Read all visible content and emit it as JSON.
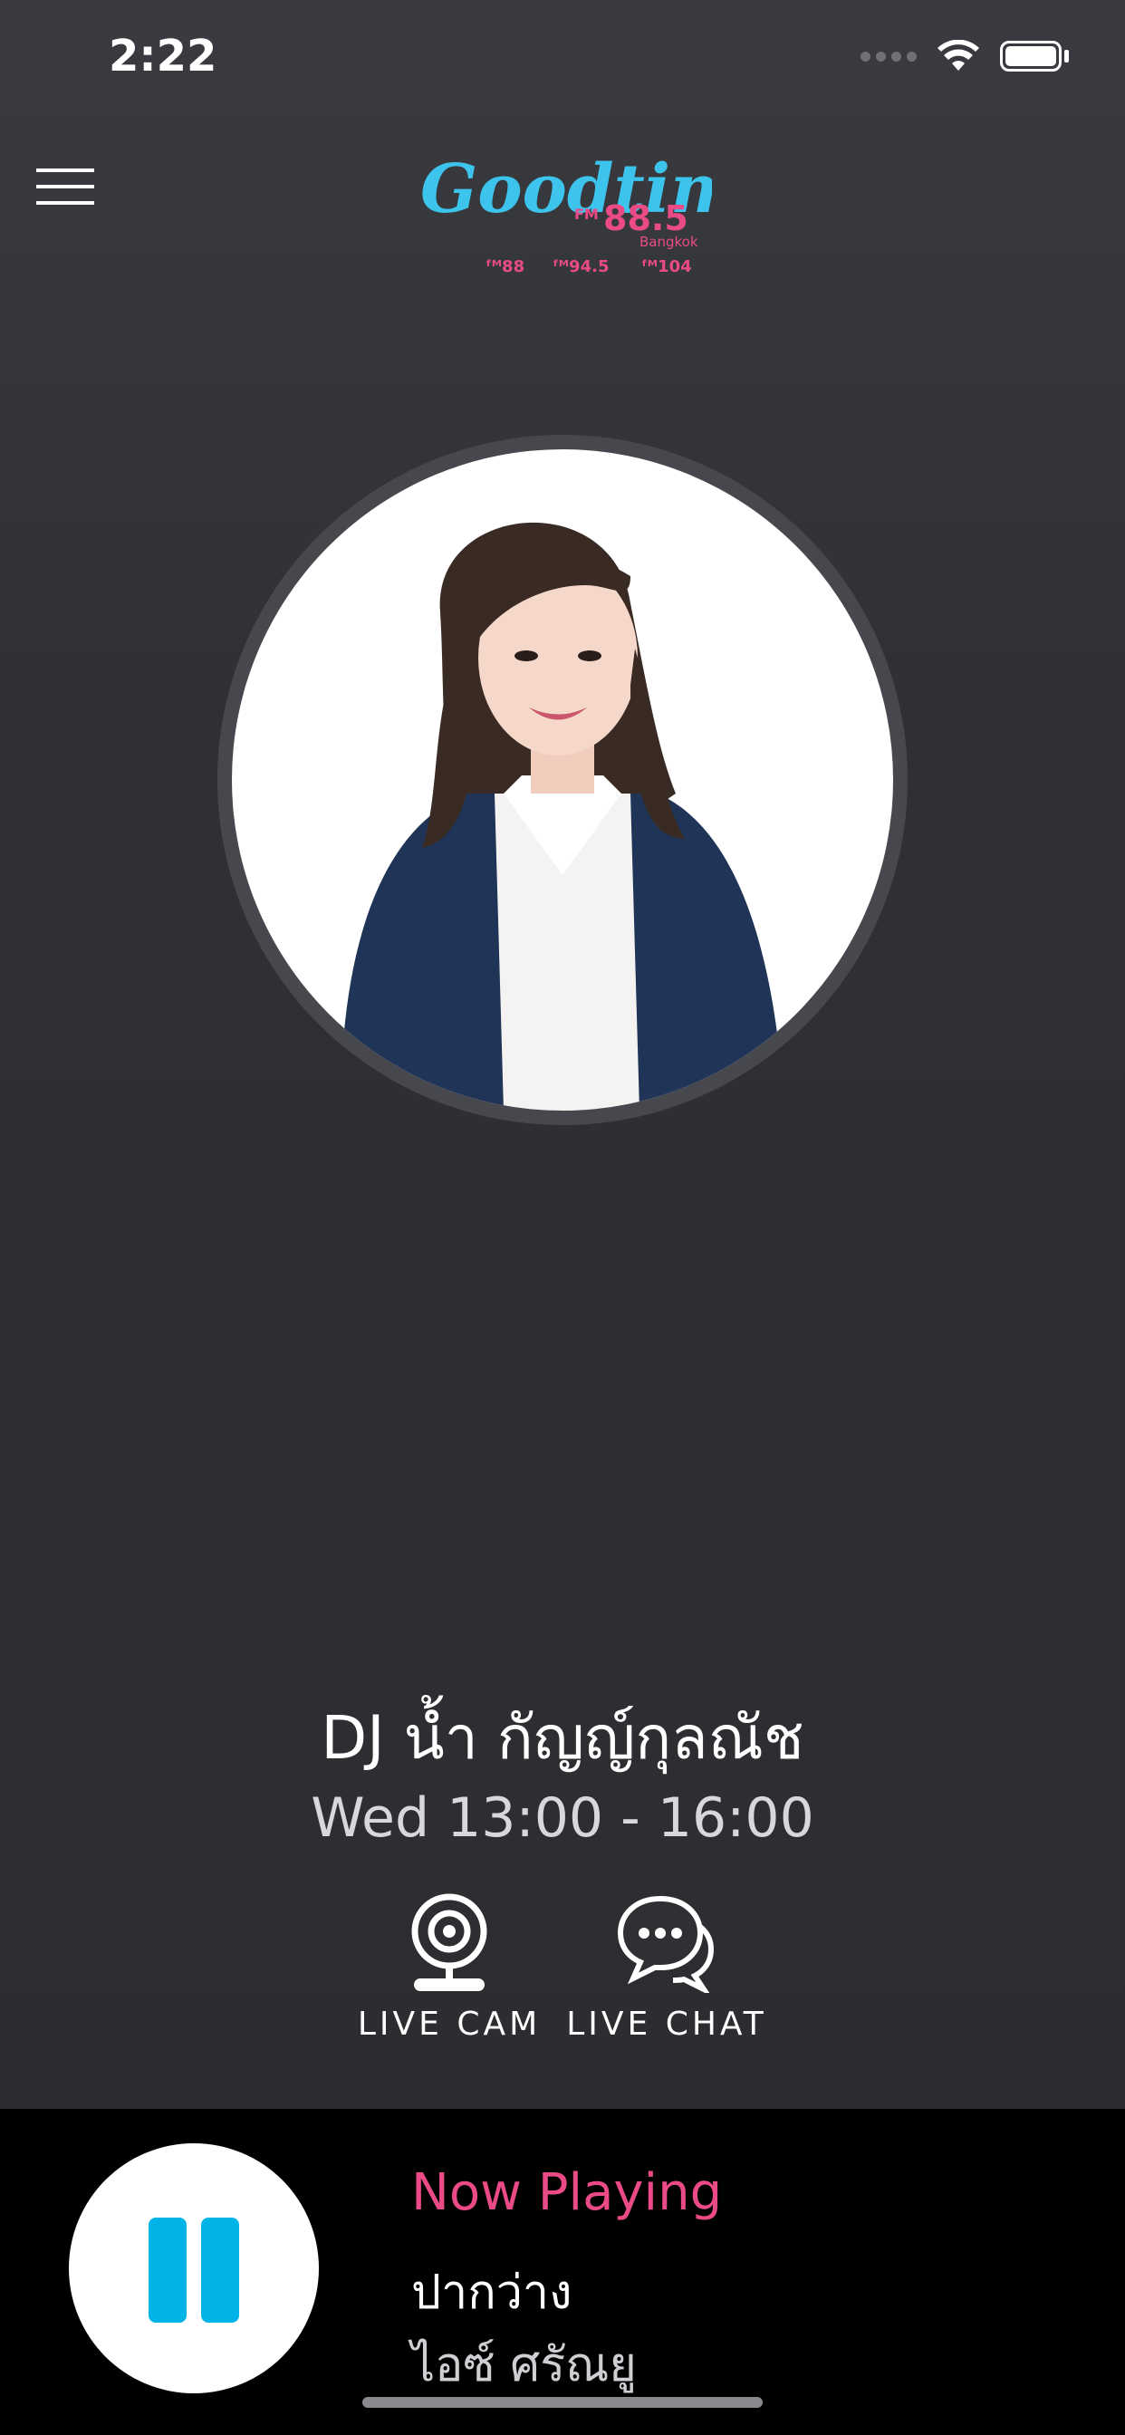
{
  "status_bar": {
    "time": "2:22",
    "wifi_icon": "wifi-icon",
    "battery_icon": "battery-icon"
  },
  "header": {
    "menu_icon": "hamburger-menu-icon",
    "logo": {
      "brand": "Goodtime",
      "main_frequency": "FM 88.5",
      "main_city": "Bangkok",
      "stations": [
        "FM 88",
        "FM 94.5",
        "FM 104"
      ]
    }
  },
  "dj": {
    "name": "DJ น้ำ กัญญ์กุลณัช",
    "schedule": "Wed 13:00 - 16:00"
  },
  "actions": [
    {
      "label": "LIVE CAM",
      "icon": "webcam-icon"
    },
    {
      "label": "LIVE CHAT",
      "icon": "chat-bubbles-icon"
    }
  ],
  "player": {
    "state_icon": "pause-icon",
    "now_playing_label": "Now Playing",
    "song": "ปากว่าง",
    "artist": "ไอซ์ ศรัณยู"
  },
  "colors": {
    "accent_pink": "#ea4a86",
    "accent_blue": "#00b4e8",
    "logo_blue": "#3cc4ec"
  }
}
